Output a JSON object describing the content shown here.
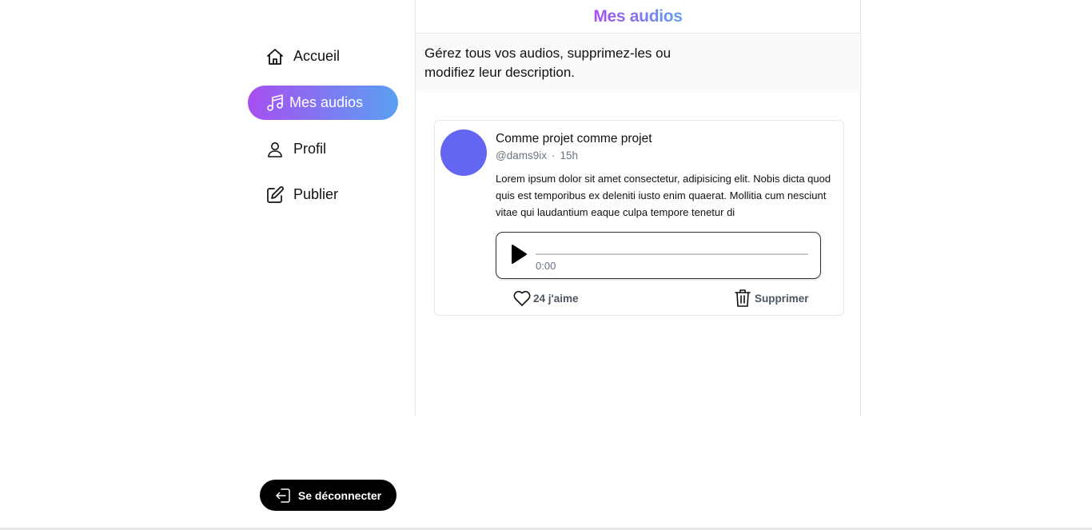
{
  "sidebar": {
    "items": [
      {
        "label": "Accueil",
        "icon": "home-icon"
      },
      {
        "label": "Mes audios",
        "icon": "music-icon",
        "active": true
      },
      {
        "label": "Profil",
        "icon": "user-icon"
      },
      {
        "label": "Publier",
        "icon": "edit-icon"
      }
    ],
    "logout_label": "Se déconnecter"
  },
  "header": {
    "title": "Mes audios"
  },
  "intro": {
    "text": "Gérez tous vos audios, supprimez-les ou modifiez leur description."
  },
  "post": {
    "title": "Comme projet comme projet",
    "handle": "@dams9ix",
    "separator": "·",
    "time_ago": "15h",
    "body": "Lorem ipsum dolor sit amet consectetur, adipisicing elit. Nobis dicta quod quis est temporibus ex deleniti iusto enim quaerat. Mollitia cum nesciunt vitae qui laudantium eaque culpa tempore tenetur di",
    "avatar_color": "#6366f1",
    "player": {
      "time": "0:00"
    },
    "likes_label": "24 j'aime",
    "delete_label": "Supprimer"
  },
  "colors": {
    "gradient_start": "#a74ff0",
    "gradient_end": "#5aa0f2"
  }
}
